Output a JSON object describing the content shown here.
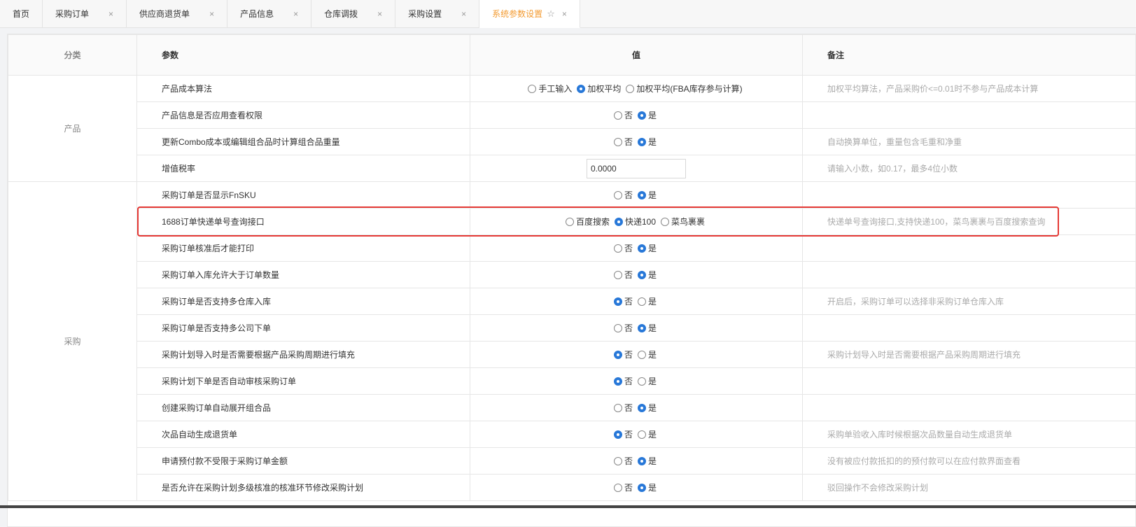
{
  "tabs": [
    {
      "label": "首页",
      "closable": false
    },
    {
      "label": "采购订单",
      "closable": true
    },
    {
      "label": "供应商退货单",
      "closable": true
    },
    {
      "label": "产品信息",
      "closable": true
    },
    {
      "label": "仓库调拨",
      "closable": true
    },
    {
      "label": "采购设置",
      "closable": true
    },
    {
      "label": "系统参数设置",
      "closable": true,
      "active": true
    }
  ],
  "close_glyph": "×",
  "star_glyph": "☆",
  "headers": {
    "category": "分类",
    "param": "参数",
    "value": "值",
    "note": "备注"
  },
  "categories": {
    "product": "产品",
    "purchase": "采购"
  },
  "rows": [
    {
      "param": "产品成本算法",
      "type": "radio",
      "options": [
        {
          "label": "手工输入",
          "checked": false
        },
        {
          "label": "加权平均",
          "checked": true
        },
        {
          "label": "加权平均(FBA库存参与计算)",
          "checked": false
        }
      ],
      "note": "加权平均算法，产品采购价<=0.01时不参与产品成本计算"
    },
    {
      "param": "产品信息是否应用查看权限",
      "type": "radio",
      "options": [
        {
          "label": "否",
          "checked": false
        },
        {
          "label": "是",
          "checked": true
        }
      ],
      "note": ""
    },
    {
      "param": "更新Combo成本或编辑组合品时计算组合品重量",
      "type": "radio",
      "options": [
        {
          "label": "否",
          "checked": false
        },
        {
          "label": "是",
          "checked": true
        }
      ],
      "note": "自动换算单位，重量包含毛重和净重"
    },
    {
      "param": "增值税率",
      "type": "input",
      "value": "0.0000",
      "note": "请输入小数，如0.17，最多4位小数"
    },
    {
      "param": "采购订单是否显示FnSKU",
      "type": "radio",
      "options": [
        {
          "label": "否",
          "checked": false
        },
        {
          "label": "是",
          "checked": true
        }
      ],
      "note": ""
    },
    {
      "param": "1688订单快递单号查询接口",
      "type": "radio",
      "options": [
        {
          "label": "百度搜索",
          "checked": false
        },
        {
          "label": "快递100",
          "checked": true
        },
        {
          "label": "菜鸟裹裹",
          "checked": false
        }
      ],
      "note": "快递单号查询接口,支持快递100，菜鸟裹裹与百度搜索查询"
    },
    {
      "param": "采购订单核准后才能打印",
      "type": "radio",
      "options": [
        {
          "label": "否",
          "checked": false
        },
        {
          "label": "是",
          "checked": true
        }
      ],
      "note": ""
    },
    {
      "param": "采购订单入库允许大于订单数量",
      "type": "radio",
      "options": [
        {
          "label": "否",
          "checked": false
        },
        {
          "label": "是",
          "checked": true
        }
      ],
      "note": ""
    },
    {
      "param": "采购订单是否支持多仓库入库",
      "type": "radio",
      "options": [
        {
          "label": "否",
          "checked": true
        },
        {
          "label": "是",
          "checked": false
        }
      ],
      "note": "开启后，采购订单可以选择非采购订单仓库入库"
    },
    {
      "param": "采购订单是否支持多公司下单",
      "type": "radio",
      "options": [
        {
          "label": "否",
          "checked": false
        },
        {
          "label": "是",
          "checked": true
        }
      ],
      "note": ""
    },
    {
      "param": "采购计划导入时是否需要根据产品采购周期进行填充",
      "type": "radio",
      "options": [
        {
          "label": "否",
          "checked": true
        },
        {
          "label": "是",
          "checked": false
        }
      ],
      "note": "采购计划导入时是否需要根据产品采购周期进行填充"
    },
    {
      "param": "采购计划下单是否自动审核采购订单",
      "type": "radio",
      "options": [
        {
          "label": "否",
          "checked": true
        },
        {
          "label": "是",
          "checked": false
        }
      ],
      "note": ""
    },
    {
      "param": "创建采购订单自动展开组合品",
      "type": "radio",
      "options": [
        {
          "label": "否",
          "checked": false
        },
        {
          "label": "是",
          "checked": true
        }
      ],
      "note": ""
    },
    {
      "param": "次品自动生成退货单",
      "type": "radio",
      "options": [
        {
          "label": "否",
          "checked": true
        },
        {
          "label": "是",
          "checked": false
        }
      ],
      "note": "采购单验收入库时候根据次品数量自动生成退货单"
    },
    {
      "param": "申请预付款不受限于采购订单金额",
      "type": "radio",
      "options": [
        {
          "label": "否",
          "checked": false
        },
        {
          "label": "是",
          "checked": true
        }
      ],
      "note": "没有被应付款抵扣的的预付款可以在应付款界面查看"
    },
    {
      "param": "是否允许在采购计划多级核准的核准环节修改采购计划",
      "type": "radio",
      "options": [
        {
          "label": "否",
          "checked": false
        },
        {
          "label": "是",
          "checked": true
        }
      ],
      "note": "驳回操作不会修改采购计划"
    }
  ]
}
